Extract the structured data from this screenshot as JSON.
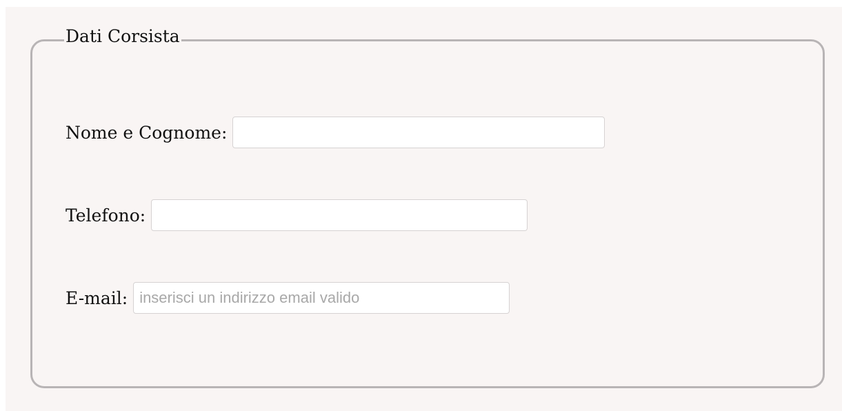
{
  "form": {
    "legend": "Dati Corsista",
    "fields": {
      "name": {
        "label": "Nome e Cognome:",
        "value": "",
        "placeholder": ""
      },
      "phone": {
        "label": "Telefono:",
        "value": "",
        "placeholder": ""
      },
      "email": {
        "label": "E-mail:",
        "value": "",
        "placeholder": "inserisci un indirizzo email valido"
      }
    }
  },
  "colors": {
    "page_background": "#f9f5f4",
    "fieldset_border": "#b8b4b5",
    "input_border": "#d6d2d2",
    "placeholder_text": "#a8a8a8"
  }
}
